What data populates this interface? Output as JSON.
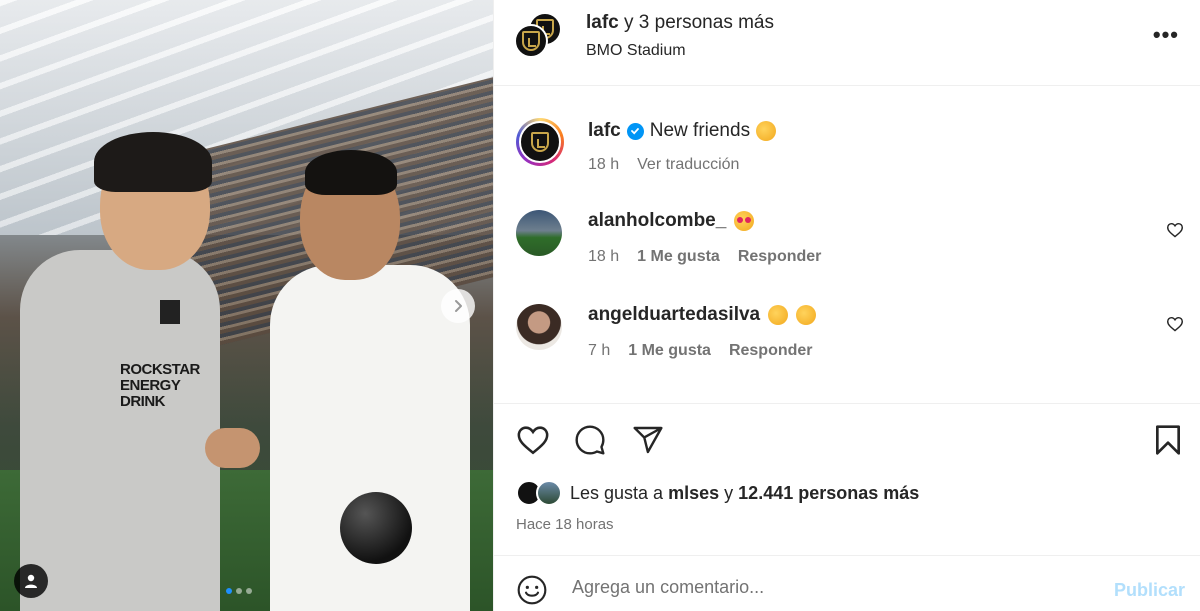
{
  "post": {
    "photo_alt": "",
    "carousel_dots": 3,
    "active_dot": 0
  },
  "header": {
    "username": "lafc",
    "collab_text": "y 3 personas más",
    "location": "BMO Stadium"
  },
  "caption": {
    "username": "lafc",
    "text": "New friends",
    "time": "18 h",
    "translate_label": "Ver traducción"
  },
  "comments": [
    {
      "username": "alanholcombe_",
      "time": "18 h",
      "likes": "1 Me gusta",
      "reply_label": "Responder"
    },
    {
      "username": "angelduartedasilva",
      "time": "7 h",
      "likes": "1 Me gusta",
      "reply_label": "Responder"
    }
  ],
  "likes": {
    "prefix": "Les gusta a",
    "first_user": "mlses",
    "joiner": "y",
    "others": "12.441 personas más",
    "time_ago": "Hace 18 horas"
  },
  "comment_box": {
    "placeholder": "Agrega un comentario...",
    "publish_label": "Publicar"
  },
  "colors": {
    "accent_blue": "#0095f6",
    "publish_disabled": "#b2dffc",
    "muted_text": "#737373"
  },
  "photo_text": {
    "jersey": "ROCKSTAR ENERGY DRINK"
  }
}
